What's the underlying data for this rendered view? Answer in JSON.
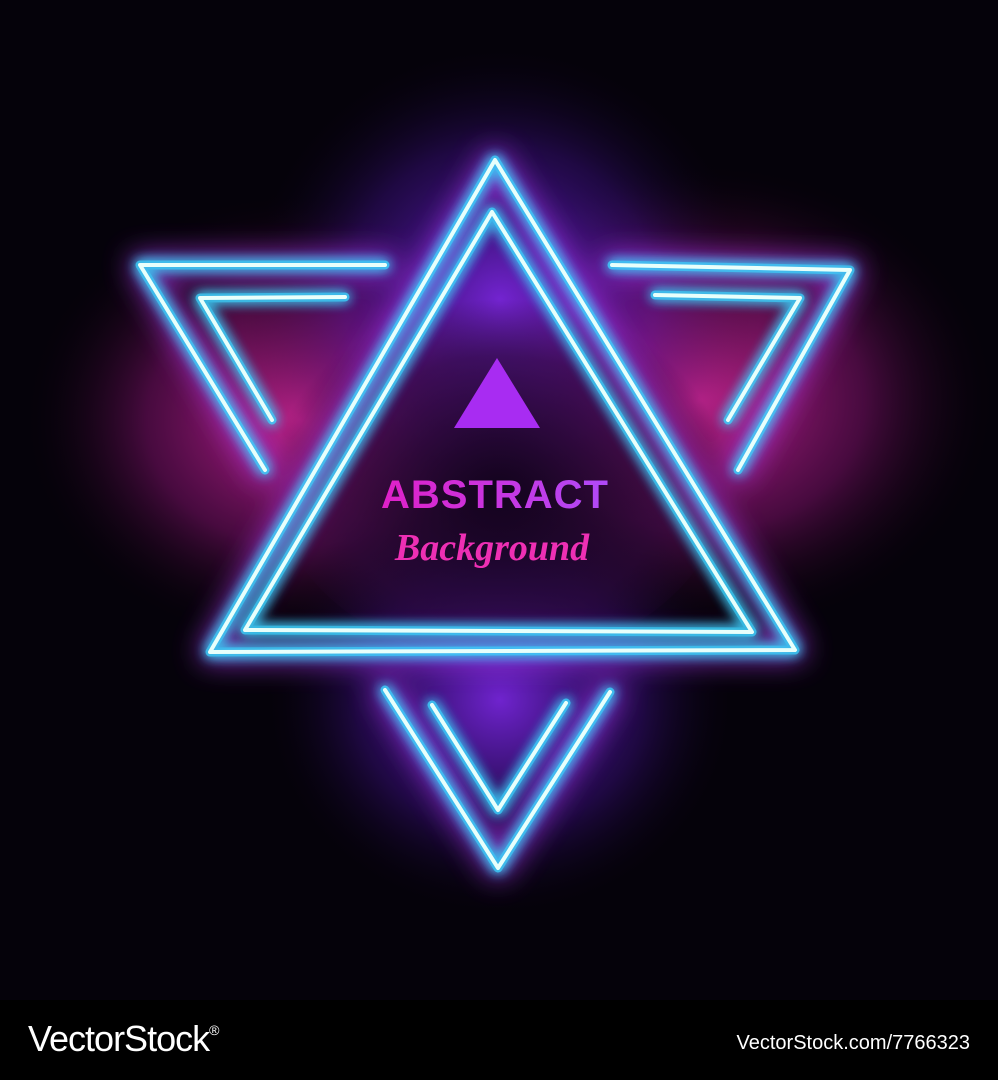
{
  "artwork": {
    "title": "ABSTRACT",
    "subtitle": "Background",
    "colors": {
      "background": "#05020a",
      "neon_line": "#e8fffb",
      "neon_glow_cyan": "#3ad6ff",
      "glow_magenta": "#ff2fb8",
      "glow_violet": "#8a2cff",
      "accent_triangle": "#a82cf2",
      "title_gradient_start": "#e020c8",
      "title_gradient_end": "#b04af8",
      "subtitle_color": "#ee2fb4"
    },
    "icons": [
      "triangle-icon"
    ]
  },
  "footer": {
    "brand": "VectorStock",
    "trademark": "®",
    "image_id": "VectorStock.com/7766323"
  }
}
